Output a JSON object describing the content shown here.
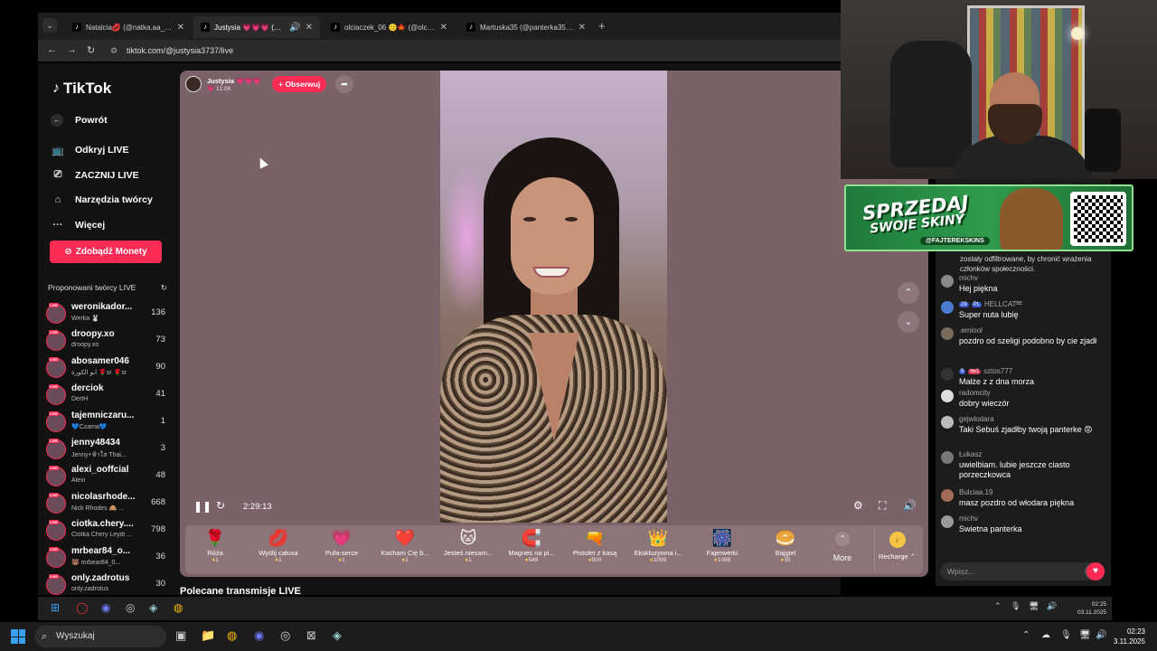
{
  "browser": {
    "tabs": [
      {
        "label": "Natalcia💋 (@natka.aa_) prow"
      },
      {
        "label": "Justysia 💗💗💗 (@justysi"
      },
      {
        "label": "olciaczek_06 🙂🍁 (@olciacze"
      },
      {
        "label": "Martuska35 (@panterka355) pr"
      }
    ],
    "new_tab": "+",
    "url": "tiktok.com/@justysia3737/live"
  },
  "sidebar": {
    "logo": "TikTok",
    "back": "Powrót",
    "nav": [
      {
        "label": "Odkryj LIVE",
        "icon": "tv-icon"
      },
      {
        "label": "ZACZNIJ LIVE",
        "icon": "camera-icon"
      },
      {
        "label": "Narzędzia twórcy",
        "icon": "home-icon"
      },
      {
        "label": "Więcej",
        "icon": "more-icon"
      }
    ],
    "coins_button": "Zdobądź Monety",
    "suggested_title": "Proponowani twórcy LIVE",
    "creators": [
      {
        "name": "weronikador...",
        "sub": "Werka 🐰",
        "count": "136"
      },
      {
        "name": "droopy.xo",
        "sub": "droopy.xo",
        "count": "73"
      },
      {
        "name": "abosamer046",
        "sub": "ابو الكورة 🌹sr 🌹sr",
        "count": "90"
      },
      {
        "name": "derciok",
        "sub": "DertH",
        "count": "41"
      },
      {
        "name": "tajemniczaru...",
        "sub": "💙Czama💙",
        "count": "1"
      },
      {
        "name": "jenny48434",
        "sub": "Jenny+ฟ้าใส Thai...",
        "count": "3"
      },
      {
        "name": "alexi_ooffcial",
        "sub": "Alexi",
        "count": "48"
      },
      {
        "name": "nicolasrhode...",
        "sub": "Nick Rhodes 🙈 ...",
        "count": "668"
      },
      {
        "name": "ciotka.chery....",
        "sub": "Ciotka Chery Leydi ...",
        "count": "798"
      },
      {
        "name": "mrbear84_o...",
        "sub": "🐻 mrbear84_0...",
        "count": "36"
      },
      {
        "name": "only.zadrotus",
        "sub": "only.zadrotus",
        "count": "30"
      }
    ]
  },
  "player": {
    "host_name": "Justysia 💗💗💗",
    "host_likes": "💗 12.0K",
    "follow_label": "+ Obserwuj",
    "timer": "2:29:13",
    "gifts": [
      {
        "icon": "🌹",
        "name": "Róża",
        "price": "1"
      },
      {
        "icon": "💋",
        "name": "Wyślij całusa",
        "price": "1"
      },
      {
        "icon": "💗",
        "name": "Pufa-serce",
        "price": "1"
      },
      {
        "icon": "❤️",
        "name": "Kocham Cię b...",
        "price": "1"
      },
      {
        "icon": "🐱",
        "name": "Jesteś niesam...",
        "price": "1"
      },
      {
        "icon": "🧲",
        "name": "Magnes na pi...",
        "price": "549"
      },
      {
        "icon": "🔫",
        "name": "Pistolet z kasą",
        "price": "500"
      },
      {
        "icon": "👑",
        "name": "Ekskluzywna i...",
        "price": "1099"
      },
      {
        "icon": "🎆",
        "name": "Fajerwerki",
        "price": "1088"
      },
      {
        "icon": "🥯",
        "name": "Bajgiel",
        "price": "35"
      }
    ],
    "more_label": "More",
    "recharge_label": "Recharge ⌃"
  },
  "recommended_title": "Polecane transmisje LIVE",
  "chat": {
    "notice": "zostały odfiltrowane, by chronić wrażenia członków społeczności.",
    "messages": [
      {
        "user": "michv",
        "badge": "",
        "badge2": "",
        "text": "Hej piękna"
      },
      {
        "user": "HELLCATᴮᴱ",
        "badge": "29",
        "badge2": "PL",
        "text": "Super nuta lubię"
      },
      {
        "user": ".emiool",
        "badge": "",
        "badge2": "",
        "text": "pozdro od szeligi podobno by cie zjadł"
      },
      {
        "user": "sztos777",
        "badge": "5",
        "badge2": "№1",
        "text": "Małże z z dna morza"
      },
      {
        "user": "radomcity",
        "badge": "",
        "badge2": "",
        "text": "dobry wieczór"
      },
      {
        "user": "gejwlodara",
        "badge": "",
        "badge2": "",
        "text": "Taki Sebuś zjadłby twoją panterke 😡"
      },
      {
        "user": "Łukasz",
        "badge": "",
        "badge2": "",
        "text": "uwielbiam. lubie jeszcze ciasto porzeczkowca"
      },
      {
        "user": "Bulciaa.19",
        "badge": "",
        "badge2": "",
        "text": "masz pozdro od włodara piękna"
      },
      {
        "user": "michv",
        "badge": "",
        "badge2": "",
        "text": "Swietna panterka"
      }
    ],
    "input_placeholder": "Wpisz..."
  },
  "ad": {
    "line1": "SPRZEDAJ",
    "line2": "SWOJE SKINY",
    "handle": "@FAJTEREKSKINS"
  },
  "taskbar": {
    "search": "Wyszukaj",
    "time": "02:23",
    "date": "3.11.2025",
    "inner_time": "02:25",
    "inner_date": "03.11.2025"
  }
}
